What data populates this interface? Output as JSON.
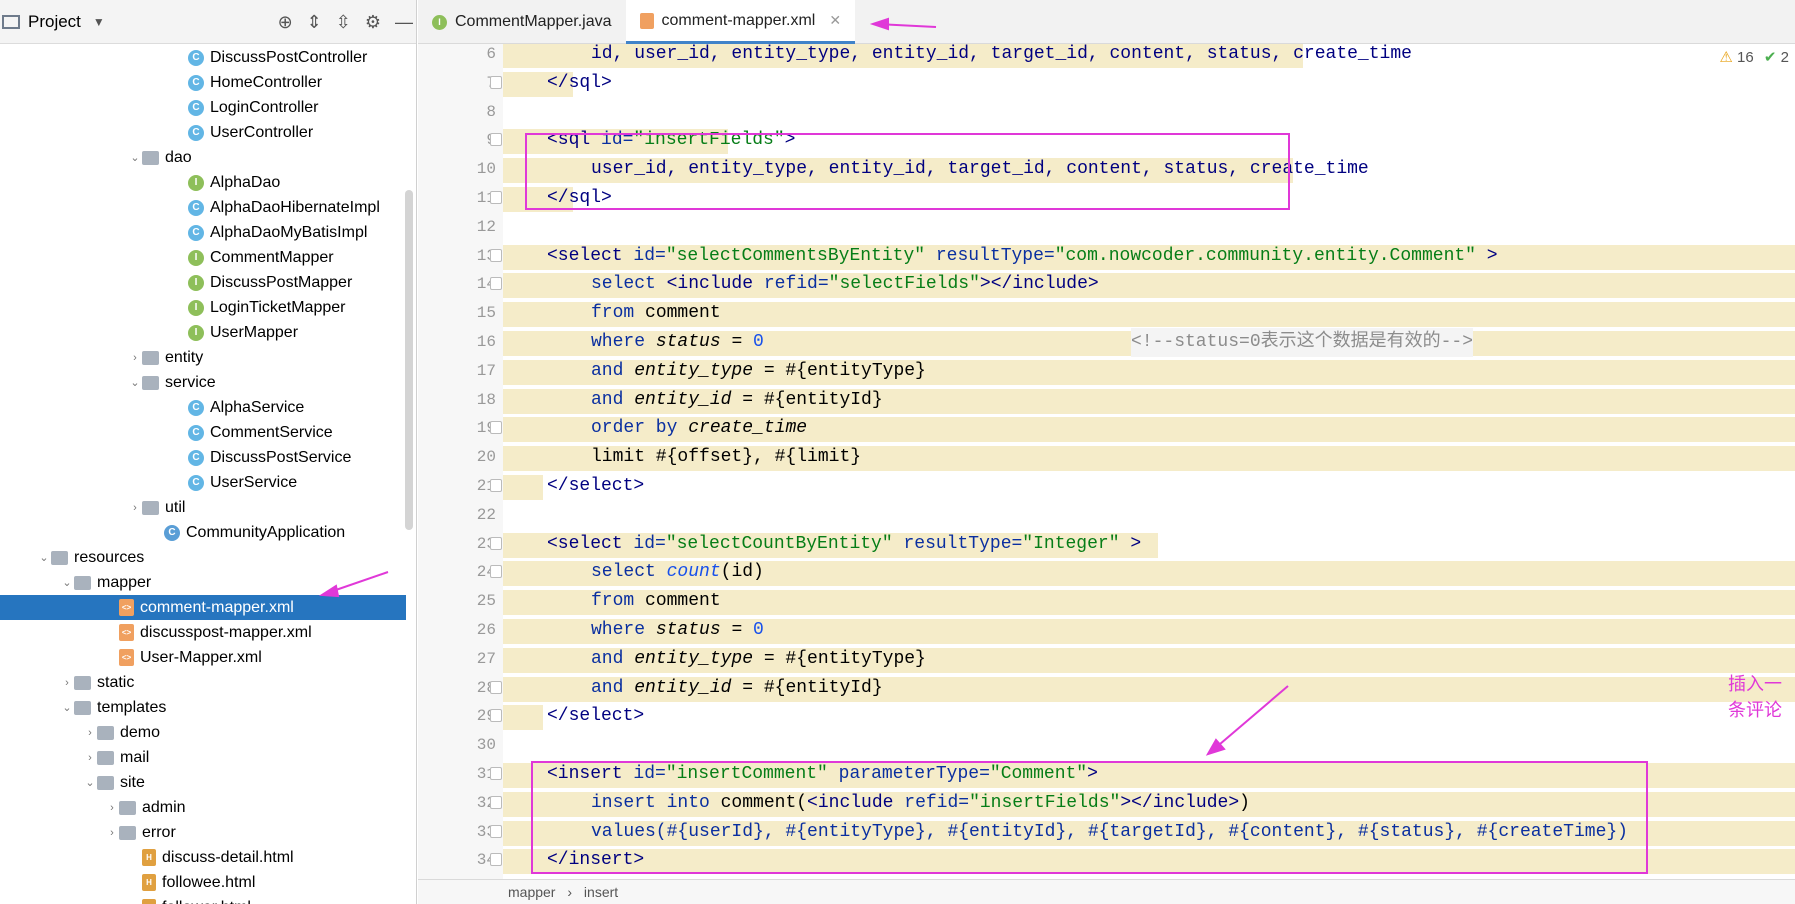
{
  "project_panel": {
    "title": "Project"
  },
  "tree": [
    {
      "label": "DiscussPostController",
      "icon": "class-icon"
    },
    {
      "label": "HomeController",
      "icon": "class-icon"
    },
    {
      "label": "LoginController",
      "icon": "class-icon"
    },
    {
      "label": "UserController",
      "icon": "class-icon"
    },
    {
      "label": "dao",
      "icon": "folder-icon",
      "expanded": true
    },
    {
      "label": "AlphaDao",
      "icon": "interface-icon"
    },
    {
      "label": "AlphaDaoHibernateImpl",
      "icon": "class-icon"
    },
    {
      "label": "AlphaDaoMyBatisImpl",
      "icon": "class-icon"
    },
    {
      "label": "CommentMapper",
      "icon": "interface-icon"
    },
    {
      "label": "DiscussPostMapper",
      "icon": "interface-icon"
    },
    {
      "label": "LoginTicketMapper",
      "icon": "interface-icon"
    },
    {
      "label": "UserMapper",
      "icon": "interface-icon"
    },
    {
      "label": "entity",
      "icon": "folder-icon",
      "expanded": false
    },
    {
      "label": "service",
      "icon": "folder-icon",
      "expanded": true
    },
    {
      "label": "AlphaService",
      "icon": "class-icon"
    },
    {
      "label": "CommentService",
      "icon": "class-icon"
    },
    {
      "label": "DiscussPostService",
      "icon": "class-icon"
    },
    {
      "label": "UserService",
      "icon": "class-icon"
    },
    {
      "label": "util",
      "icon": "folder-icon",
      "expanded": false
    },
    {
      "label": "CommunityApplication",
      "icon": "app-icon"
    },
    {
      "label": "resources",
      "icon": "folder-icon",
      "expanded": true
    },
    {
      "label": "mapper",
      "icon": "folder-icon",
      "expanded": true
    },
    {
      "label": "comment-mapper.xml",
      "icon": "xml-icon",
      "selected": true
    },
    {
      "label": "discusspost-mapper.xml",
      "icon": "xml-icon"
    },
    {
      "label": "User-Mapper.xml",
      "icon": "xml-icon"
    },
    {
      "label": "static",
      "icon": "folder-icon",
      "expanded": false
    },
    {
      "label": "templates",
      "icon": "folder-icon",
      "expanded": true
    },
    {
      "label": "demo",
      "icon": "folder-icon",
      "expanded": false
    },
    {
      "label": "mail",
      "icon": "folder-icon",
      "expanded": false
    },
    {
      "label": "site",
      "icon": "folder-icon",
      "expanded": true
    },
    {
      "label": "admin",
      "icon": "folder-icon",
      "expanded": false
    },
    {
      "label": "error",
      "icon": "folder-icon",
      "expanded": false
    },
    {
      "label": "discuss-detail.html",
      "icon": "html-icon"
    },
    {
      "label": "followee.html",
      "icon": "html-icon"
    },
    {
      "label": "follower.html",
      "icon": "html-icon"
    }
  ],
  "tabs": [
    {
      "label": "CommentMapper.java",
      "active": false
    },
    {
      "label": "comment-mapper.xml",
      "active": true
    }
  ],
  "warnings": {
    "warn_count": "16",
    "ok_count": "2"
  },
  "line_numbers": [
    "6",
    "7",
    "8",
    "9",
    "10",
    "11",
    "12",
    "13",
    "14",
    "15",
    "16",
    "17",
    "18",
    "19",
    "20",
    "21",
    "22",
    "23",
    "24",
    "25",
    "26",
    "27",
    "28",
    "29",
    "30",
    "31",
    "32",
    "33",
    "34"
  ],
  "code": {
    "l6": "id, user_id, entity_type, entity_id, target_id, content, status, create_time",
    "l7": "</sql>",
    "l9a": "<sql ",
    "l9b": "id=",
    "l9c": "\"insertFields\"",
    "l9d": ">",
    "l10": "user_id, entity_type, entity_id, target_id, content, status, create_time",
    "l11": "</sql>",
    "l13a": "<select ",
    "l13b": "id=",
    "l13c": "\"selectCommentsByEntity\"",
    "l13d": " resultType=",
    "l13e": "\"com.nowcoder.community.entity.Comment\"",
    "l13f": " >",
    "l14a": "select ",
    "l14b": "<include ",
    "l14c": "refid=",
    "l14d": "\"selectFields\"",
    "l14e": "></include>",
    "l15a": "from",
    "l15b": " comment",
    "l16a": "where",
    "l16b": " status",
    "l16c": " = ",
    "l16d": "0",
    "l16e": "<!--status=0表示这个数据是有效的-->",
    "l17a": "and",
    "l17b": " entity_type",
    "l17c": " = #{entityType}",
    "l18a": "and",
    "l18b": " entity_id",
    "l18c": " = #{entityId}",
    "l19a": "order by",
    "l19b": " create_time",
    "l20": "limit #{offset}, #{limit}",
    "l21": "</select>",
    "l23a": "<select ",
    "l23b": "id=",
    "l23c": "\"selectCountByEntity\"",
    "l23d": " resultType=",
    "l23e": "\"Integer\"",
    "l23f": " >",
    "l24a": "select ",
    "l24b": "count",
    "l24c": "(id)",
    "l25a": "from",
    "l25b": " comment",
    "l26a": "where",
    "l26b": " status",
    "l26c": " = ",
    "l26d": "0",
    "l27a": "and",
    "l27b": " entity_type",
    "l27c": " = #{entityType}",
    "l28a": "and",
    "l28b": " entity_id",
    "l28c": " = #{entityId}",
    "l29": "</select>",
    "l31a": "<insert ",
    "l31b": "id=",
    "l31c": "\"insertComment\"",
    "l31d": " parameterType=",
    "l31e": "\"Comment\"",
    "l31f": ">",
    "l32a": "insert into",
    "l32b": " comment(",
    "l32c": "<include ",
    "l32d": "refid=",
    "l32e": "\"insertFields\"",
    "l32f": "></include>",
    "l32g": ")",
    "l33": "values(#{userId}, #{entityType}, #{entityId}, #{targetId}, #{content}, #{status}, #{createTime})",
    "l34": "</insert>"
  },
  "annotation": "插入一条评论",
  "breadcrumb": {
    "first": "mapper",
    "second": "insert"
  },
  "colors": {
    "highlight": "#f5ecc9",
    "annotation": "#e038d8",
    "selection": "#2675bf"
  }
}
